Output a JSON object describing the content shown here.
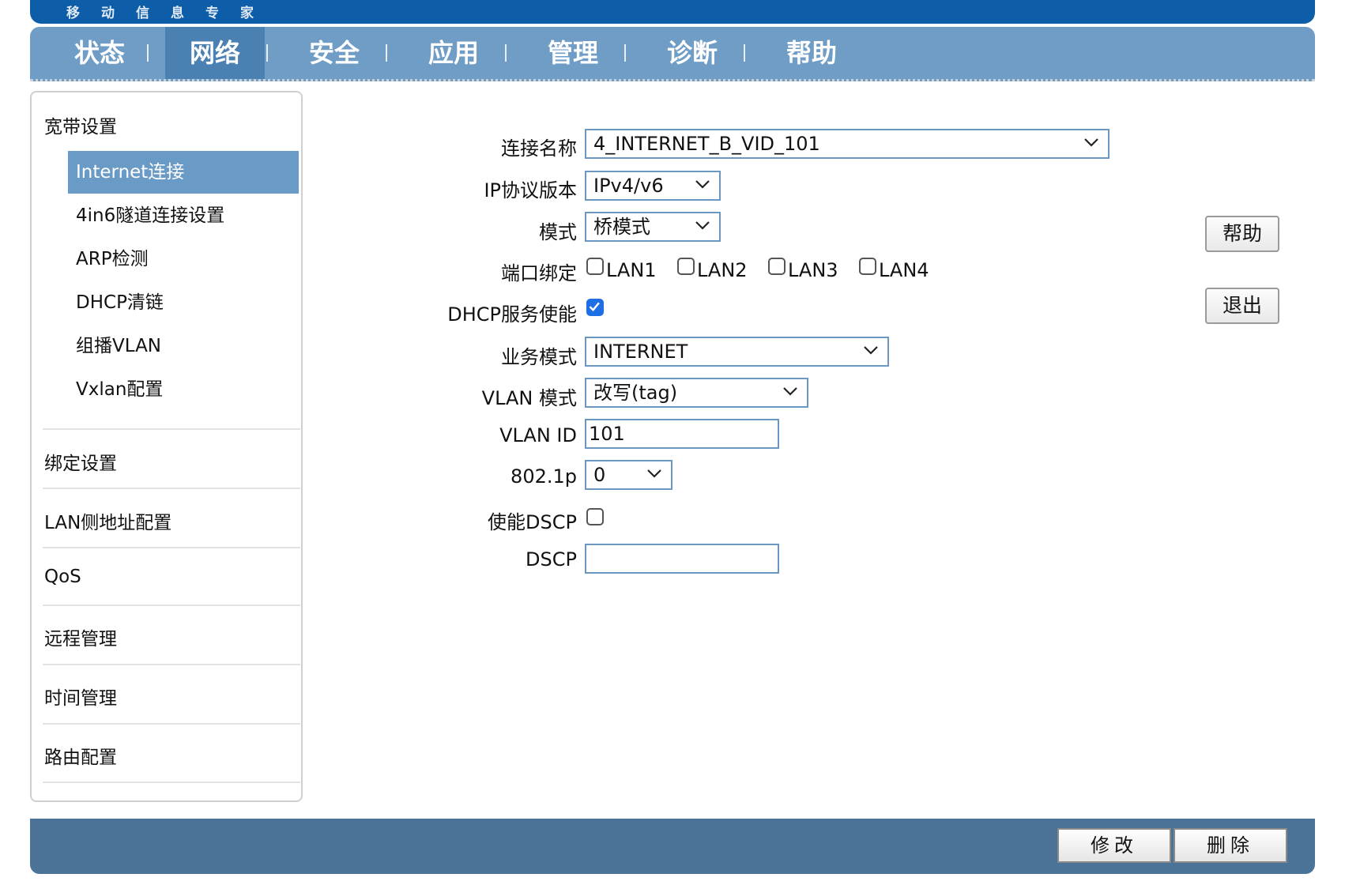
{
  "brand": {
    "text": "移动信息专家"
  },
  "nav": {
    "items": [
      {
        "label": "状态"
      },
      {
        "label": "网络"
      },
      {
        "label": "安全"
      },
      {
        "label": "应用"
      },
      {
        "label": "管理"
      },
      {
        "label": "诊断"
      },
      {
        "label": "帮助"
      }
    ],
    "active": "网络"
  },
  "sidebar": {
    "broadband_group": "宽带设置",
    "broadband_items": [
      {
        "label": "Internet连接"
      },
      {
        "label": "4in6隧道连接设置"
      },
      {
        "label": "ARP检测"
      },
      {
        "label": "DHCP清链"
      },
      {
        "label": "组播VLAN"
      },
      {
        "label": "Vxlan配置"
      }
    ],
    "active_item": "Internet连接",
    "groups": [
      {
        "label": "绑定设置"
      },
      {
        "label": "LAN侧地址配置"
      },
      {
        "label": "QoS"
      },
      {
        "label": "远程管理"
      },
      {
        "label": "时间管理"
      },
      {
        "label": "路由配置"
      }
    ]
  },
  "form": {
    "connection_name": {
      "label": "连接名称",
      "value": "4_INTERNET_B_VID_101"
    },
    "ip_version": {
      "label": "IP协议版本",
      "value": "IPv4/v6"
    },
    "mode": {
      "label": "模式",
      "value": "桥模式"
    },
    "port_binding": {
      "label": "端口绑定",
      "ports": [
        {
          "label": "LAN1",
          "checked": false
        },
        {
          "label": "LAN2",
          "checked": false
        },
        {
          "label": "LAN3",
          "checked": false
        },
        {
          "label": "LAN4",
          "checked": false
        }
      ]
    },
    "dhcp_server": {
      "label": "DHCP服务使能",
      "checked": true
    },
    "service_mode": {
      "label": "业务模式",
      "value": "INTERNET"
    },
    "vlan_mode": {
      "label": "VLAN 模式",
      "value": "改写(tag)"
    },
    "vlan_id": {
      "label": "VLAN ID",
      "value": "101"
    },
    "priority": {
      "label": "802.1p",
      "value": "0"
    },
    "enable_dscp": {
      "label": "使能DSCP",
      "checked": false
    },
    "dscp": {
      "label": "DSCP",
      "value": ""
    }
  },
  "buttons": {
    "help": "帮助",
    "exit": "退出",
    "modify": "修改",
    "delete": "删除"
  },
  "colors": {
    "brand_bar": "#0e5da8",
    "nav_bar": "#6f9dc6",
    "nav_active": "#4a80b2",
    "side_active": "#6a9ac6",
    "footer": "#4a7397",
    "checkbox_checked": "#1e6ee6"
  },
  "icons": {
    "dropdown": "chevron-down-icon",
    "check": "checkmark-icon"
  }
}
